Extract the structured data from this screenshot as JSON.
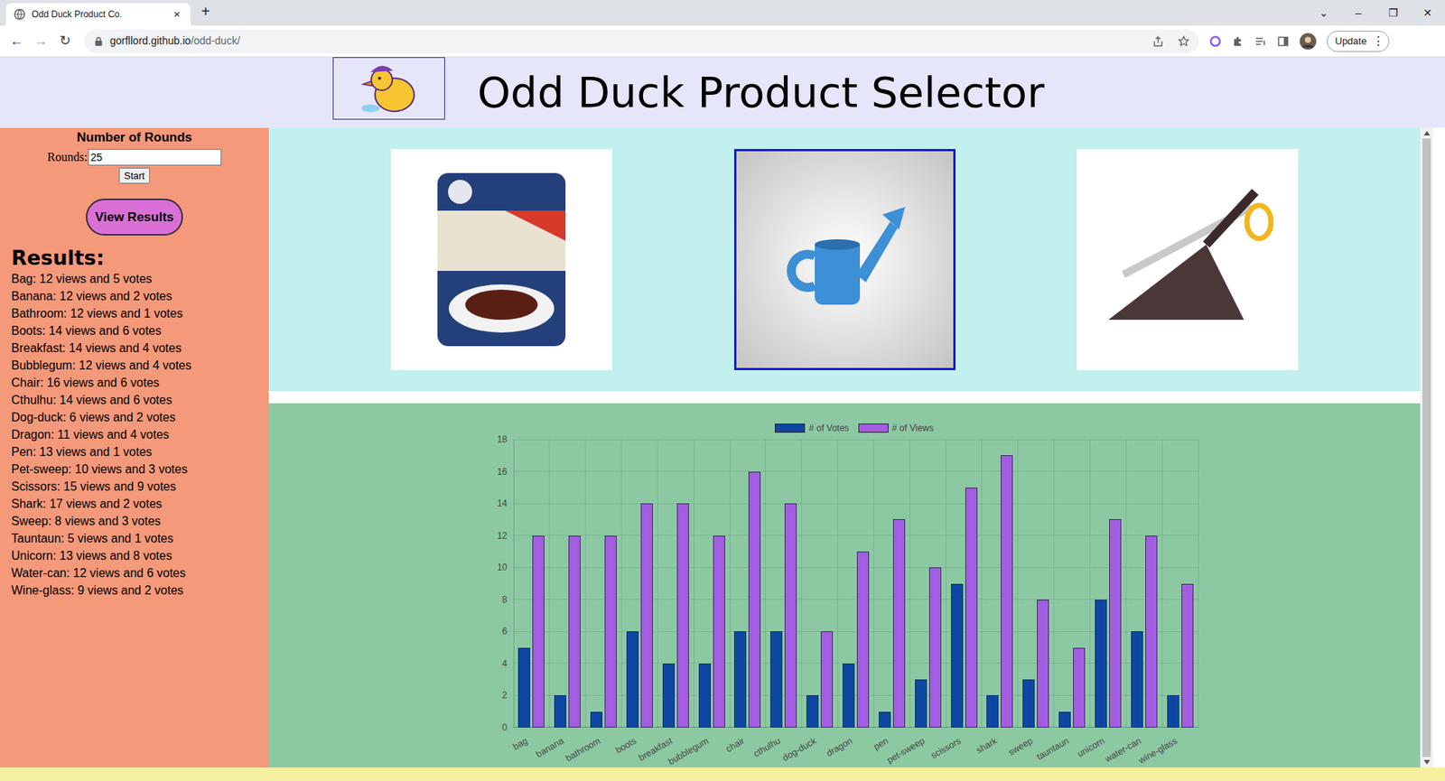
{
  "browser": {
    "tab_title": "Odd Duck Product Co.",
    "tab_close": "×",
    "new_tab": "+",
    "window_controls": [
      "⌄",
      "–",
      "❐",
      "✕"
    ],
    "nav": [
      "←",
      "→",
      "↻"
    ],
    "url": {
      "host": "gorfllord.github.io",
      "path": "/odd-duck/"
    },
    "update": "Update",
    "menu": "⋮"
  },
  "header": {
    "title": "Odd Duck Product Selector"
  },
  "sidebar": {
    "rounds_heading": "Number of Rounds",
    "rounds_label": "Rounds:",
    "rounds_value": "25",
    "start": "Start",
    "view_results": "View Results",
    "results_heading": "Results:",
    "results": [
      "Bag: 12 views and 5 votes",
      "Banana: 12 views and 2 votes",
      "Bathroom: 12 views and 1 votes",
      "Boots: 14 views and 6 votes",
      "Breakfast: 14 views and 4 votes",
      "Bubblegum: 12 views and 4 votes",
      "Chair: 16 views and 6 votes",
      "Cthulhu: 14 views and 6 votes",
      "Dog-duck: 6 views and 2 votes",
      "Dragon: 11 views and 4 votes",
      "Pen: 13 views and 1 votes",
      "Pet-sweep: 10 views and 3 votes",
      "Scissors: 15 views and 9 votes",
      "Shark: 17 views and 2 votes",
      "Sweep: 8 views and 3 votes",
      "Tauntaun: 5 views and 1 votes",
      "Unicorn: 13 views and 8 votes",
      "Water-can: 12 views and 6 votes",
      "Wine-glass: 9 views and 2 votes"
    ]
  },
  "products": [
    {
      "selected": false
    },
    {
      "selected": true
    },
    {
      "selected": false
    }
  ],
  "chart": {
    "legend": [
      {
        "label": "# of Votes",
        "color": "#0d47a1"
      },
      {
        "label": "# of Views",
        "color": "#a25de0"
      }
    ],
    "y_ticks": [
      "18",
      "16",
      "14",
      "12",
      "10",
      "8",
      "6",
      "4",
      "2",
      "0"
    ],
    "y_max": 18,
    "categories": [
      "bag",
      "banana",
      "bathroom",
      "boots",
      "breakfast",
      "bubblegum",
      "chair",
      "cthulhu",
      "dog-duck",
      "dragon",
      "pen",
      "pet-sweep",
      "scissors",
      "shark",
      "sweep",
      "tauntaun",
      "unicorn",
      "water-can",
      "wine-glass"
    ],
    "votes": [
      5,
      2,
      1,
      6,
      4,
      4,
      6,
      6,
      2,
      4,
      1,
      3,
      9,
      2,
      3,
      1,
      8,
      6,
      2
    ],
    "views": [
      12,
      12,
      12,
      14,
      14,
      12,
      16,
      14,
      6,
      11,
      13,
      10,
      15,
      17,
      8,
      5,
      13,
      12,
      9
    ]
  }
}
